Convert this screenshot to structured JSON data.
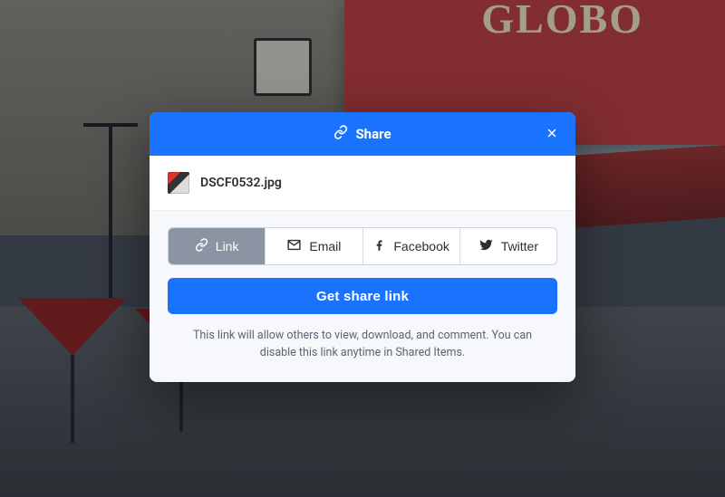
{
  "background": {
    "sign_text": "GLOBO"
  },
  "modal": {
    "title": "Share",
    "file_name": "DSCF0532.jpg",
    "tabs": {
      "link": {
        "label": "Link"
      },
      "email": {
        "label": "Email"
      },
      "facebook": {
        "label": "Facebook"
      },
      "twitter": {
        "label": "Twitter"
      }
    },
    "primary_button_label": "Get share link",
    "hint_text": "This link will allow others to view, download, and comment. You can disable this link anytime in Shared Items."
  }
}
